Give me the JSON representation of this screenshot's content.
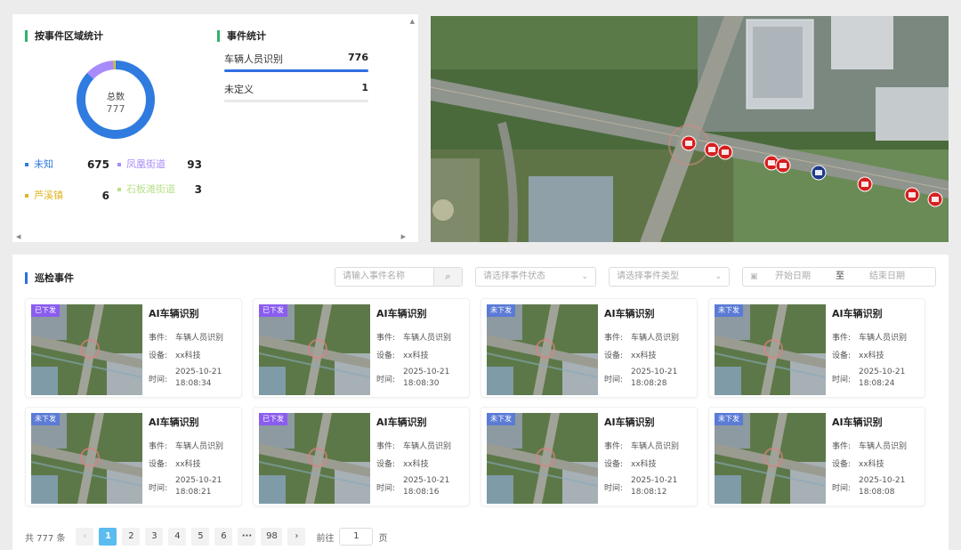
{
  "region_stats": {
    "title": "按事件区域统计",
    "total_label": "总数",
    "total_value": "777",
    "legend": [
      {
        "name": "未知",
        "value": 675,
        "color": "#2f7be0"
      },
      {
        "name": "凤凰街道",
        "value": 93,
        "color": "#a78bfa"
      },
      {
        "name": "芦溪镇",
        "value": 6,
        "color": "#e0b420"
      },
      {
        "name": "石板滩街道",
        "value": 3,
        "color": "#b8e08a"
      }
    ]
  },
  "event_stats": {
    "title": "事件统计",
    "rows": [
      {
        "name": "车辆人员识别",
        "value": 776,
        "fraction": 1.0
      },
      {
        "name": "未定义",
        "value": 1,
        "fraction": 0.0
      }
    ]
  },
  "patrol": {
    "title": "巡检事件",
    "search_placeholder": "请输入事件名称",
    "status_placeholder": "请选择事件状态",
    "type_placeholder": "请选择事件类型",
    "start_date_placeholder": "开始日期",
    "date_sep": "至",
    "end_date_placeholder": "结束日期",
    "labels": {
      "event": "事件:",
      "device": "设备:",
      "time": "时间:"
    },
    "cards": [
      {
        "status": "已下发",
        "sent": true,
        "title": "AI车辆识别",
        "event": "车辆人员识别",
        "device": "xx科技",
        "date": "2025-10-21",
        "time": "18:08:34"
      },
      {
        "status": "已下发",
        "sent": true,
        "title": "AI车辆识别",
        "event": "车辆人员识别",
        "device": "xx科技",
        "date": "2025-10-21",
        "time": "18:08:30"
      },
      {
        "status": "未下发",
        "sent": false,
        "title": "AI车辆识别",
        "event": "车辆人员识别",
        "device": "xx科技",
        "date": "2025-10-21",
        "time": "18:08:28"
      },
      {
        "status": "未下发",
        "sent": false,
        "title": "AI车辆识别",
        "event": "车辆人员识别",
        "device": "xx科技",
        "date": "2025-10-21",
        "time": "18:08:24"
      },
      {
        "status": "未下发",
        "sent": false,
        "title": "AI车辆识别",
        "event": "车辆人员识别",
        "device": "xx科技",
        "date": "2025-10-21",
        "time": "18:08:21"
      },
      {
        "status": "已下发",
        "sent": true,
        "title": "AI车辆识别",
        "event": "车辆人员识别",
        "device": "xx科技",
        "date": "2025-10-21",
        "time": "18:08:16"
      },
      {
        "status": "未下发",
        "sent": false,
        "title": "AI车辆识别",
        "event": "车辆人员识别",
        "device": "xx科技",
        "date": "2025-10-21",
        "time": "18:08:12"
      },
      {
        "status": "未下发",
        "sent": false,
        "title": "AI车辆识别",
        "event": "车辆人员识别",
        "device": "xx科技",
        "date": "2025-10-21",
        "time": "18:08:08"
      }
    ]
  },
  "pagination": {
    "total_text": "共 777 条",
    "prev": "‹",
    "pages": [
      "1",
      "2",
      "3",
      "4",
      "5",
      "6"
    ],
    "ellipsis": "···",
    "last": "98",
    "next": "›",
    "goto_prefix": "前往",
    "goto_value": "1",
    "goto_suffix": "页",
    "current": 1
  }
}
